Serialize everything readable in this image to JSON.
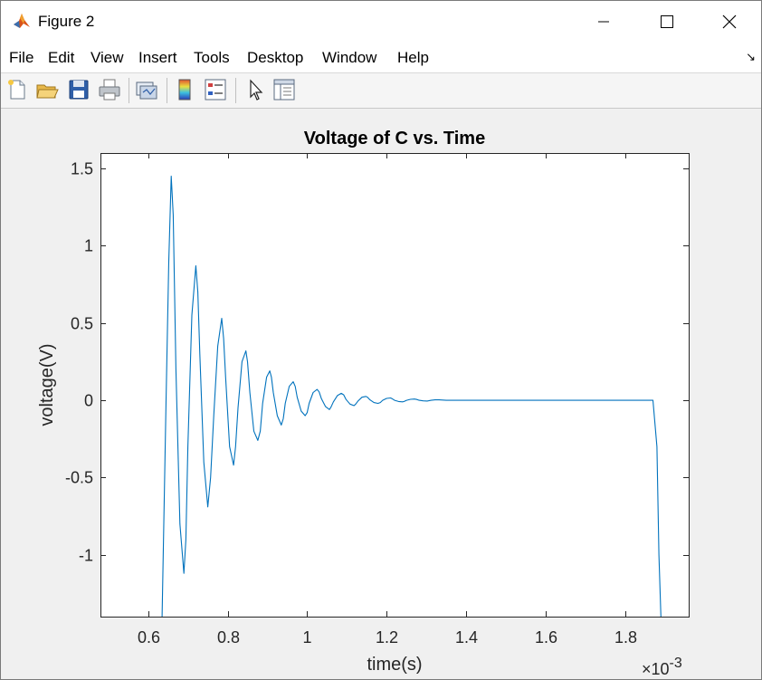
{
  "window": {
    "title": "Figure 2",
    "icon": "matlab-icon",
    "controls": [
      "minimize-icon",
      "maximize-icon",
      "close-icon"
    ]
  },
  "menubar": {
    "items": [
      "File",
      "Edit",
      "View",
      "Insert",
      "Tools",
      "Desktop",
      "Window",
      "Help"
    ],
    "dock_arrow": "↘"
  },
  "toolbar": {
    "buttons": [
      "new-figure-icon",
      "open-file-icon",
      "save-icon",
      "print-icon",
      "link-plot-icon",
      "colorbar-icon",
      "legend-icon",
      "edit-plot-pointer-icon",
      "property-inspector-icon"
    ]
  },
  "chart_data": {
    "type": "line",
    "title": "Voltage of C vs. Time",
    "xlabel": "time(s)",
    "ylabel": "voltage(V)",
    "x_exponent_label": "×10",
    "x_exponent": "-3",
    "xlim": [
      0.00048,
      0.00196
    ],
    "ylim": [
      -1.4,
      1.6
    ],
    "x_ticks": [
      0.0006,
      0.0008,
      0.001,
      0.0012,
      0.0014,
      0.0016,
      0.0018
    ],
    "x_tick_labels": [
      "0.6",
      "0.8",
      "1",
      "1.2",
      "1.4",
      "1.6",
      "1.8"
    ],
    "y_ticks": [
      -1,
      -0.5,
      0,
      0.5,
      1,
      1.5
    ],
    "y_tick_labels": [
      "-1",
      "-0.5",
      "0",
      "0.5",
      "1",
      "1.5"
    ],
    "grid": false,
    "series": [
      {
        "color": "#0072bd",
        "x": [
          0.000635,
          0.000645,
          0.000652,
          0.000658,
          0.000663,
          0.00067,
          0.00068,
          0.00069,
          0.000695,
          0.0007,
          0.00071,
          0.00072,
          0.000725,
          0.00073,
          0.00074,
          0.00075,
          0.000757,
          0.000765,
          0.000775,
          0.000785,
          0.00079,
          0.000795,
          0.000805,
          0.000815,
          0.00082,
          0.000826,
          0.000836,
          0.000846,
          0.00085,
          0.000856,
          0.000866,
          0.000876,
          0.000882,
          0.000888,
          0.000898,
          0.000906,
          0.00091,
          0.000915,
          0.000925,
          0.000935,
          0.00094,
          0.000945,
          0.000955,
          0.000965,
          0.00097,
          0.000975,
          0.000985,
          0.000995,
          0.001,
          0.001005,
          0.001015,
          0.001025,
          0.00103,
          0.001036,
          0.001046,
          0.001056,
          0.00106,
          0.001066,
          0.001076,
          0.001086,
          0.001092,
          0.001098,
          0.001108,
          0.001118,
          0.001122,
          0.001128,
          0.001138,
          0.001148,
          0.001152,
          0.001158,
          0.001168,
          0.001178,
          0.001184,
          0.00119,
          0.0012,
          0.00121,
          0.001214,
          0.00122,
          0.00123,
          0.00124,
          0.001244,
          0.00125,
          0.00126,
          0.00127,
          0.001276,
          0.001282,
          0.001292,
          0.001302,
          0.001306,
          0.001312,
          0.001322,
          0.001332,
          0.001336,
          0.00135,
          0.00137,
          0.0014,
          0.00145,
          0.0015,
          0.0016,
          0.0017,
          0.0018,
          0.00187,
          0.00188,
          0.001885,
          0.00189
        ],
        "y": [
          -1.4,
          0.0,
          0.9,
          1.45,
          1.2,
          0.2,
          -0.8,
          -1.12,
          -0.9,
          -0.3,
          0.55,
          0.87,
          0.7,
          0.3,
          -0.4,
          -0.69,
          -0.5,
          -0.1,
          0.35,
          0.53,
          0.4,
          0.15,
          -0.3,
          -0.42,
          -0.3,
          -0.05,
          0.25,
          0.32,
          0.25,
          0.05,
          -0.2,
          -0.26,
          -0.2,
          -0.02,
          0.15,
          0.19,
          0.15,
          0.05,
          -0.1,
          -0.16,
          -0.12,
          -0.02,
          0.09,
          0.12,
          0.09,
          0.02,
          -0.07,
          -0.1,
          -0.08,
          -0.02,
          0.05,
          0.07,
          0.055,
          0.01,
          -0.04,
          -0.06,
          -0.045,
          -0.01,
          0.03,
          0.045,
          0.035,
          0.005,
          -0.025,
          -0.035,
          -0.025,
          -0.005,
          0.02,
          0.025,
          0.02,
          0.003,
          -0.015,
          -0.02,
          -0.015,
          0.0,
          0.012,
          0.015,
          0.01,
          0.0,
          -0.008,
          -0.01,
          -0.008,
          0.0,
          0.006,
          0.008,
          0.005,
          0.0,
          -0.004,
          -0.005,
          -0.003,
          0.0,
          0.003,
          0.003,
          0.002,
          0.0,
          0.0,
          0.0,
          0.0,
          0.0,
          0.0,
          0.0,
          0.0,
          0.0,
          -0.3,
          -1.0,
          -1.4
        ]
      }
    ]
  }
}
